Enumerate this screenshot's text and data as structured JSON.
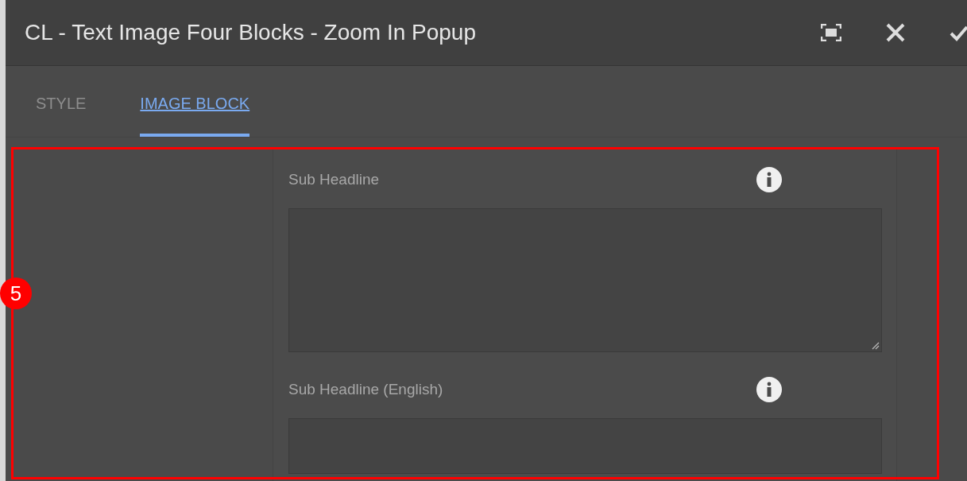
{
  "window": {
    "title": "CL - Text Image Four Blocks - Zoom In Popup"
  },
  "tabs": [
    {
      "label": "STYLE",
      "selected": false
    },
    {
      "label": "IMAGE BLOCK",
      "selected": true
    }
  ],
  "fields": [
    {
      "label": "Sub Headline",
      "kind": "textarea"
    },
    {
      "label": "Sub Headline (English)",
      "kind": "textfield"
    }
  ],
  "annotation": {
    "number": "5"
  }
}
